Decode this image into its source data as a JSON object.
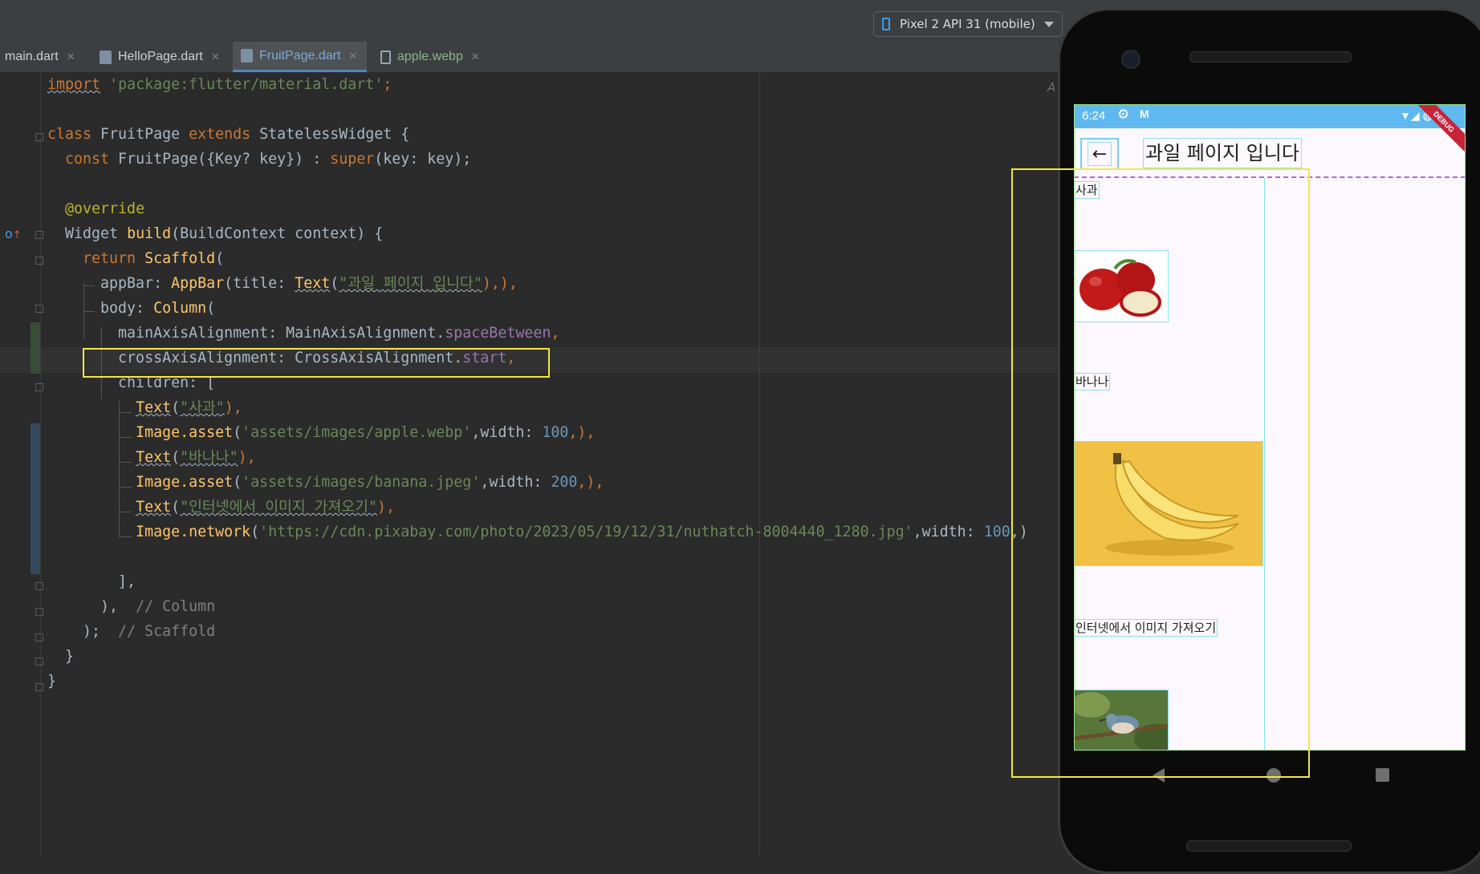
{
  "toolbar": {
    "device": "Pixel 2 API 31 (mobile)"
  },
  "tabs": [
    {
      "label": "main.dart"
    },
    {
      "label": "HelloPage.dart"
    },
    {
      "label": "FruitPage.dart"
    },
    {
      "label": "apple.webp"
    }
  ],
  "code": {
    "l1": [
      "import",
      " ",
      "'package:flutter/material.dart'",
      ";"
    ],
    "l3": [
      "class",
      " FruitPage ",
      "extends",
      " StatelessWidget {"
    ],
    "l4": [
      "  ",
      "const",
      " FruitPage({Key? key}) : ",
      "super",
      "(key: key);"
    ],
    "l6": [
      "  ",
      "@override"
    ],
    "l7": [
      "  Widget ",
      "build",
      "(BuildContext context) {"
    ],
    "l8": [
      "    ",
      "return",
      " ",
      "Scaffold",
      "("
    ],
    "l9": [
      "      appBar: ",
      "AppBar",
      "(title: ",
      "Text",
      "(",
      "\"과일 페이지 입니다\"",
      "),),"
    ],
    "l10": [
      "      body: ",
      "Column",
      "("
    ],
    "l11": [
      "        mainAxisAlignment: MainAxisAlignment.",
      "spaceBetween",
      ","
    ],
    "l12": [
      "        crossAxisAlignment: CrossAxisAlignment.",
      "start",
      ","
    ],
    "l13": [
      "        children: ["
    ],
    "l14": [
      "          ",
      "Text",
      "(",
      "\"사과\"",
      "),"
    ],
    "l15": [
      "          ",
      "Image.asset",
      "(",
      "'assets/images/apple.webp'",
      ",width: ",
      "100",
      ",),"
    ],
    "l16": [
      "          ",
      "Text",
      "(",
      "\"바나나\"",
      "),"
    ],
    "l17": [
      "          ",
      "Image.asset",
      "(",
      "'assets/images/banana.jpeg'",
      ",width: ",
      "200",
      ",),"
    ],
    "l18": [
      "          ",
      "Text",
      "(",
      "\"인터넷에서 이미지 가져오기\"",
      "),"
    ],
    "l19": [
      "          ",
      "Image.network",
      "(",
      "'https://cdn.pixabay.com/photo/2023/05/19/12/31/nuthatch-8004440_1280.jpg'",
      ",width: ",
      "100",
      ",)"
    ],
    "l21": [
      "        ],"
    ],
    "l22": [
      "      ),",
      "  // Column"
    ],
    "l23": [
      "    );",
      "  // Scaffold"
    ],
    "l24": [
      "  }"
    ],
    "l25": [
      "}"
    ]
  },
  "phone": {
    "status_time": "6:24",
    "debug_label": "DEBUG",
    "appbar_title": "과일 페이지 입니다",
    "text1": "사과",
    "text2": "바나나",
    "text3": "인터넷에서 이미지 가져오기"
  },
  "colors": {
    "editor_bg": "#2b2b2b",
    "keyword": "#cc7832",
    "string": "#6a8759",
    "number": "#6897bb",
    "highlight": "#f3e64a",
    "statusbar": "#5fb9f0"
  }
}
